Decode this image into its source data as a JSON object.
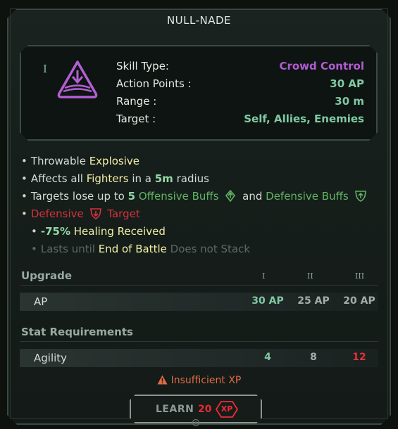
{
  "title": "NULL-NADE",
  "rank_mark": "I",
  "info": {
    "rows": [
      {
        "key": "Skill Type:",
        "value": "Crowd Control",
        "color": "#b25bd3"
      },
      {
        "key": "Action Points :",
        "value": "30 AP",
        "color": "#7fc9a3"
      },
      {
        "key": "Range :",
        "value": "30 m",
        "color": "#7fc9a3"
      },
      {
        "key": "Target :",
        "value": "Self, Allies, Enemies",
        "color": "#7fc9a3"
      }
    ]
  },
  "effects": {
    "line1": {
      "a": "Throwable",
      "b": "Explosive"
    },
    "line2": {
      "a": "Affects all",
      "b": "Fighters",
      "c": "in a",
      "d": "5m",
      "e": "radius"
    },
    "line3": {
      "a": "Targets lose up to",
      "b": "5",
      "c": "Offensive Buffs",
      "d": "and",
      "e": "Defensive Buffs"
    },
    "line4": {
      "a": "Defensive",
      "b": "Target"
    },
    "line5": {
      "a": "-75%",
      "b": "Healing Received"
    },
    "line6": {
      "a": "Lasts until",
      "b": "End of Battle",
      "c": "Does not Stack"
    }
  },
  "upgrade": {
    "heading": "Upgrade",
    "levels": [
      "I",
      "II",
      "III"
    ],
    "row_label": "AP",
    "values": [
      "30 AP",
      "25 AP",
      "20 AP"
    ]
  },
  "requirements": {
    "heading": "Stat Requirements",
    "row_label": "Agility",
    "values": [
      "4",
      "8",
      "12"
    ],
    "value_colors": [
      "#7fc9a3",
      "#a5aca8",
      "#e6303a"
    ]
  },
  "warning": "Insufficient XP",
  "learn": {
    "label": "LEARN",
    "cost": "20",
    "currency": "XP"
  },
  "icons": {
    "skill": "grenade-down-arrow-icon",
    "offensive_buff": "offensive-buff-icon",
    "defensive_buff": "defensive-buff-icon",
    "defensive_debuff": "defensive-debuff-icon",
    "warning": "warning-triangle-icon",
    "xp": "xp-badge-icon"
  }
}
